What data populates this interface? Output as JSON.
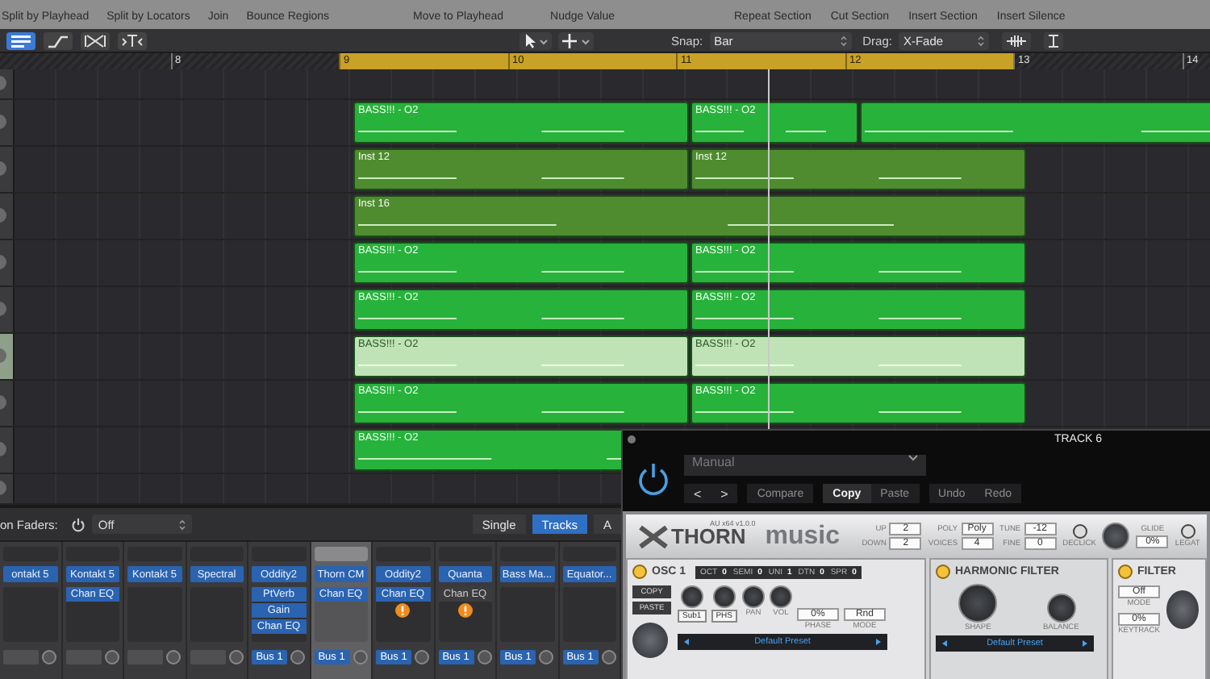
{
  "toolbar": {
    "command_groups": [
      [
        "Split by Playhead",
        "Split by Locators",
        "Join",
        "Bounce Regions"
      ],
      [
        "Move to Playhead",
        "Nudge Value"
      ],
      [
        "Repeat Section",
        "Cut Section",
        "Insert Section",
        "Insert Silence"
      ]
    ],
    "view_buttons": [
      {
        "kind": "list",
        "selected": true
      },
      {
        "kind": "automation",
        "selected": false
      },
      {
        "kind": "flex",
        "selected": false
      },
      {
        "kind": "catch",
        "selected": false
      }
    ],
    "snap": {
      "label": "Snap:",
      "value": "Bar"
    },
    "drag": {
      "label": "Drag:",
      "value": "X-Fade"
    }
  },
  "ruler": {
    "bars": [
      {
        "label": "8",
        "in_cycle": false
      },
      {
        "label": "9",
        "in_cycle": true
      },
      {
        "label": "10",
        "in_cycle": true
      },
      {
        "label": "11",
        "in_cycle": true
      },
      {
        "label": "12",
        "in_cycle": true
      },
      {
        "label": "13",
        "in_cycle": false
      },
      {
        "label": "14",
        "in_cycle": false
      }
    ]
  },
  "tracks": [
    {
      "selected": false
    },
    {
      "selected": false,
      "regions": [
        {
          "kind": "audio",
          "name": "BASS!!! - O2",
          "selected": false
        },
        {
          "kind": "audio",
          "name": "BASS!!! - O2",
          "selected": false
        },
        {
          "kind": "audio",
          "selected": false
        }
      ]
    },
    {
      "selected": false,
      "regions": [
        {
          "kind": "midi",
          "name": "Inst 12",
          "selected": false
        },
        {
          "kind": "midi",
          "name": "Inst 12",
          "selected": false
        }
      ]
    },
    {
      "selected": false,
      "regions": [
        {
          "kind": "midi",
          "name": "Inst 16",
          "selected": false
        }
      ]
    },
    {
      "selected": false,
      "regions": [
        {
          "kind": "audio",
          "name": "BASS!!! - O2",
          "selected": false
        },
        {
          "kind": "audio",
          "name": "BASS!!! - O2",
          "selected": false
        }
      ]
    },
    {
      "selected": false,
      "regions": [
        {
          "kind": "audio",
          "name": "BASS!!! - O2",
          "selected": false
        },
        {
          "kind": "audio",
          "name": "BASS!!! - O2",
          "selected": false
        }
      ]
    },
    {
      "selected": true,
      "regions": [
        {
          "kind": "audio",
          "name": "BASS!!! - O2",
          "selected": true
        },
        {
          "kind": "audio",
          "name": "BASS!!! - O2",
          "selected": true
        }
      ]
    },
    {
      "selected": false,
      "regions": [
        {
          "kind": "audio",
          "name": "BASS!!! - O2",
          "selected": false
        },
        {
          "kind": "audio",
          "name": "BASS!!! - O2",
          "selected": false
        }
      ]
    },
    {
      "selected": false,
      "regions": [
        {
          "kind": "audio",
          "name": "BASS!!! - O2",
          "selected": false
        }
      ]
    },
    {
      "selected": false
    }
  ],
  "mixer": {
    "faders_label": "on Faders:",
    "faders_value": "Off",
    "view_buttons": [
      {
        "label": "Single",
        "selected": false
      },
      {
        "label": "Tracks",
        "selected": true
      },
      {
        "label": "A",
        "selected": false
      }
    ],
    "strips": [
      {
        "instrument": "ontakt 5",
        "selected": false,
        "warning": false
      },
      {
        "instrument": "Kontakt 5",
        "inserts": [
          {
            "label": "Chan EQ",
            "active": true
          }
        ],
        "selected": false,
        "warning": false
      },
      {
        "instrument": "Kontakt 5",
        "selected": false,
        "warning": false
      },
      {
        "instrument": "Spectral",
        "selected": false,
        "warning": false
      },
      {
        "instrument": "Oddity2",
        "inserts": [
          {
            "label": "PtVerb",
            "active": true
          },
          {
            "label": "Gain",
            "active": true
          },
          {
            "label": "Chan EQ",
            "active": true
          }
        ],
        "send": "Bus 1",
        "selected": false,
        "warning": false
      },
      {
        "instrument": "Thorn CM",
        "inserts": [
          {
            "label": "Chan EQ",
            "active": true
          }
        ],
        "send": "Bus 1",
        "selected": true,
        "warning": false
      },
      {
        "instrument": "Oddity2",
        "inserts": [
          {
            "label": "Chan EQ",
            "active": true
          }
        ],
        "send": "Bus 1",
        "selected": false,
        "warning": true
      },
      {
        "instrument": "Quanta",
        "inserts": [
          {
            "label": "Chan EQ",
            "active": false
          }
        ],
        "send": "Bus 1",
        "selected": false,
        "warning": true
      },
      {
        "instrument": "Bass Ma...",
        "send": "Bus 1",
        "selected": false,
        "warning": false
      },
      {
        "instrument": "Equator...",
        "send": "Bus 1",
        "selected": false,
        "warning": false
      }
    ]
  },
  "plugin": {
    "title": "TRACK 6",
    "preset": "Manual",
    "nav": [
      "<",
      ">"
    ],
    "button_groups": [
      [
        {
          "label": "Compare",
          "selected": false
        }
      ],
      [
        {
          "label": "Copy",
          "selected": true
        },
        {
          "label": "Paste",
          "selected": false
        }
      ],
      [
        {
          "label": "Undo",
          "selected": false
        },
        {
          "label": "Redo",
          "selected": false
        }
      ]
    ],
    "synth": {
      "name": "THORN",
      "version": "AU x64 v1.0.0",
      "brand": "music",
      "params": [
        [
          {
            "label": "UP",
            "value": "2"
          },
          {
            "label": "DOWN",
            "value": "2"
          }
        ],
        [
          {
            "label": "POLY",
            "value": "Poly"
          },
          {
            "label": "VOICES",
            "value": "4"
          }
        ],
        [
          {
            "label": "TUNE",
            "value": "-12"
          },
          {
            "label": "FINE",
            "value": "0"
          }
        ]
      ],
      "declick": "DECLICK",
      "glide": {
        "label": "GLIDE",
        "value": "0%"
      },
      "legato": "LEGAT",
      "osc": {
        "title": "OSC 1",
        "params": [
          {
            "label": "OCT",
            "value": "0"
          },
          {
            "label": "SEMI",
            "value": "0"
          },
          {
            "label": "UNI",
            "value": "1"
          },
          {
            "label": "DTN",
            "value": "0"
          },
          {
            "label": "SPR",
            "value": "0"
          }
        ],
        "copy": "COPY",
        "paste": "PASTE",
        "knobs": [
          {
            "kind": "button",
            "label": "Sub1"
          },
          {
            "kind": "button",
            "label": "PHS"
          },
          {
            "kind": "text",
            "label": "PAN"
          },
          {
            "kind": "text",
            "label": "VOL"
          }
        ],
        "boxes": [
          {
            "value": "0%",
            "label": "PHASE"
          },
          {
            "value": "Rnd",
            "label": "MODE"
          }
        ],
        "preset": "Default Preset"
      },
      "harmonic": {
        "title": "HARMONIC FILTER",
        "knobs": [
          "SHAPE",
          "BALANCE"
        ],
        "preset": "Default Preset"
      },
      "filter": {
        "title": "FILTER",
        "boxes": [
          {
            "value": "Off",
            "label": "MODE"
          },
          {
            "value": "0%",
            "label": "KEYTRACK"
          }
        ]
      }
    }
  }
}
